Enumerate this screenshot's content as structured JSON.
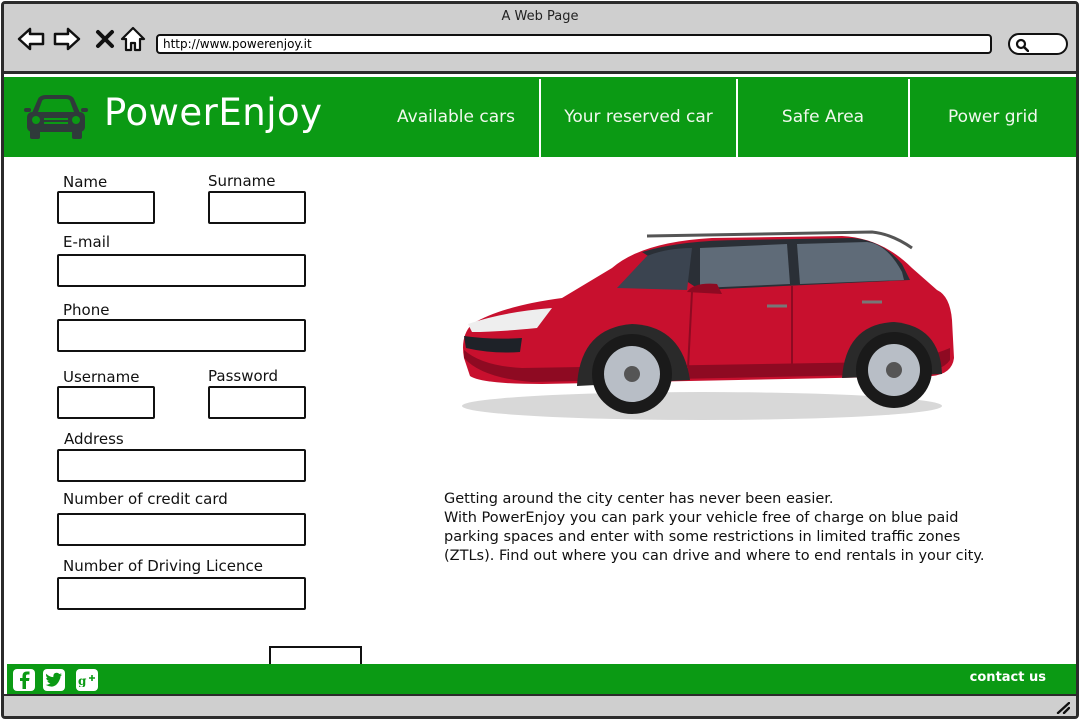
{
  "window": {
    "title": "A Web Page",
    "url": "http://www.powerenjoy.it"
  },
  "header": {
    "brand": "PowerEnjoy",
    "nav": [
      "Available cars",
      "Your reserved car",
      "Safe Area",
      "Power grid"
    ]
  },
  "form": {
    "name_label": "Name",
    "surname_label": "Surname",
    "email_label": "E-mail",
    "phone_label": "Phone",
    "username_label": "Username",
    "password_label": "Password",
    "address_label": "Address",
    "credit_card_label": "Number of credit card",
    "licence_label": "Number of Driving Licence"
  },
  "content": {
    "lines": [
      "Getting around the city center has never been easier.",
      "With PowerEnjoy you can park your vehicle free of charge on blue paid",
      "parking spaces and enter with some restrictions in limited traffic zones",
      "(ZTLs). Find out where you can drive and where to end rentals in your city."
    ]
  },
  "footer": {
    "contact": "contact us",
    "social": [
      "facebook-icon",
      "twitter-icon",
      "google-plus-icon"
    ]
  },
  "colors": {
    "brand_green": "#0b9a14",
    "car_red": "#c8102e"
  }
}
